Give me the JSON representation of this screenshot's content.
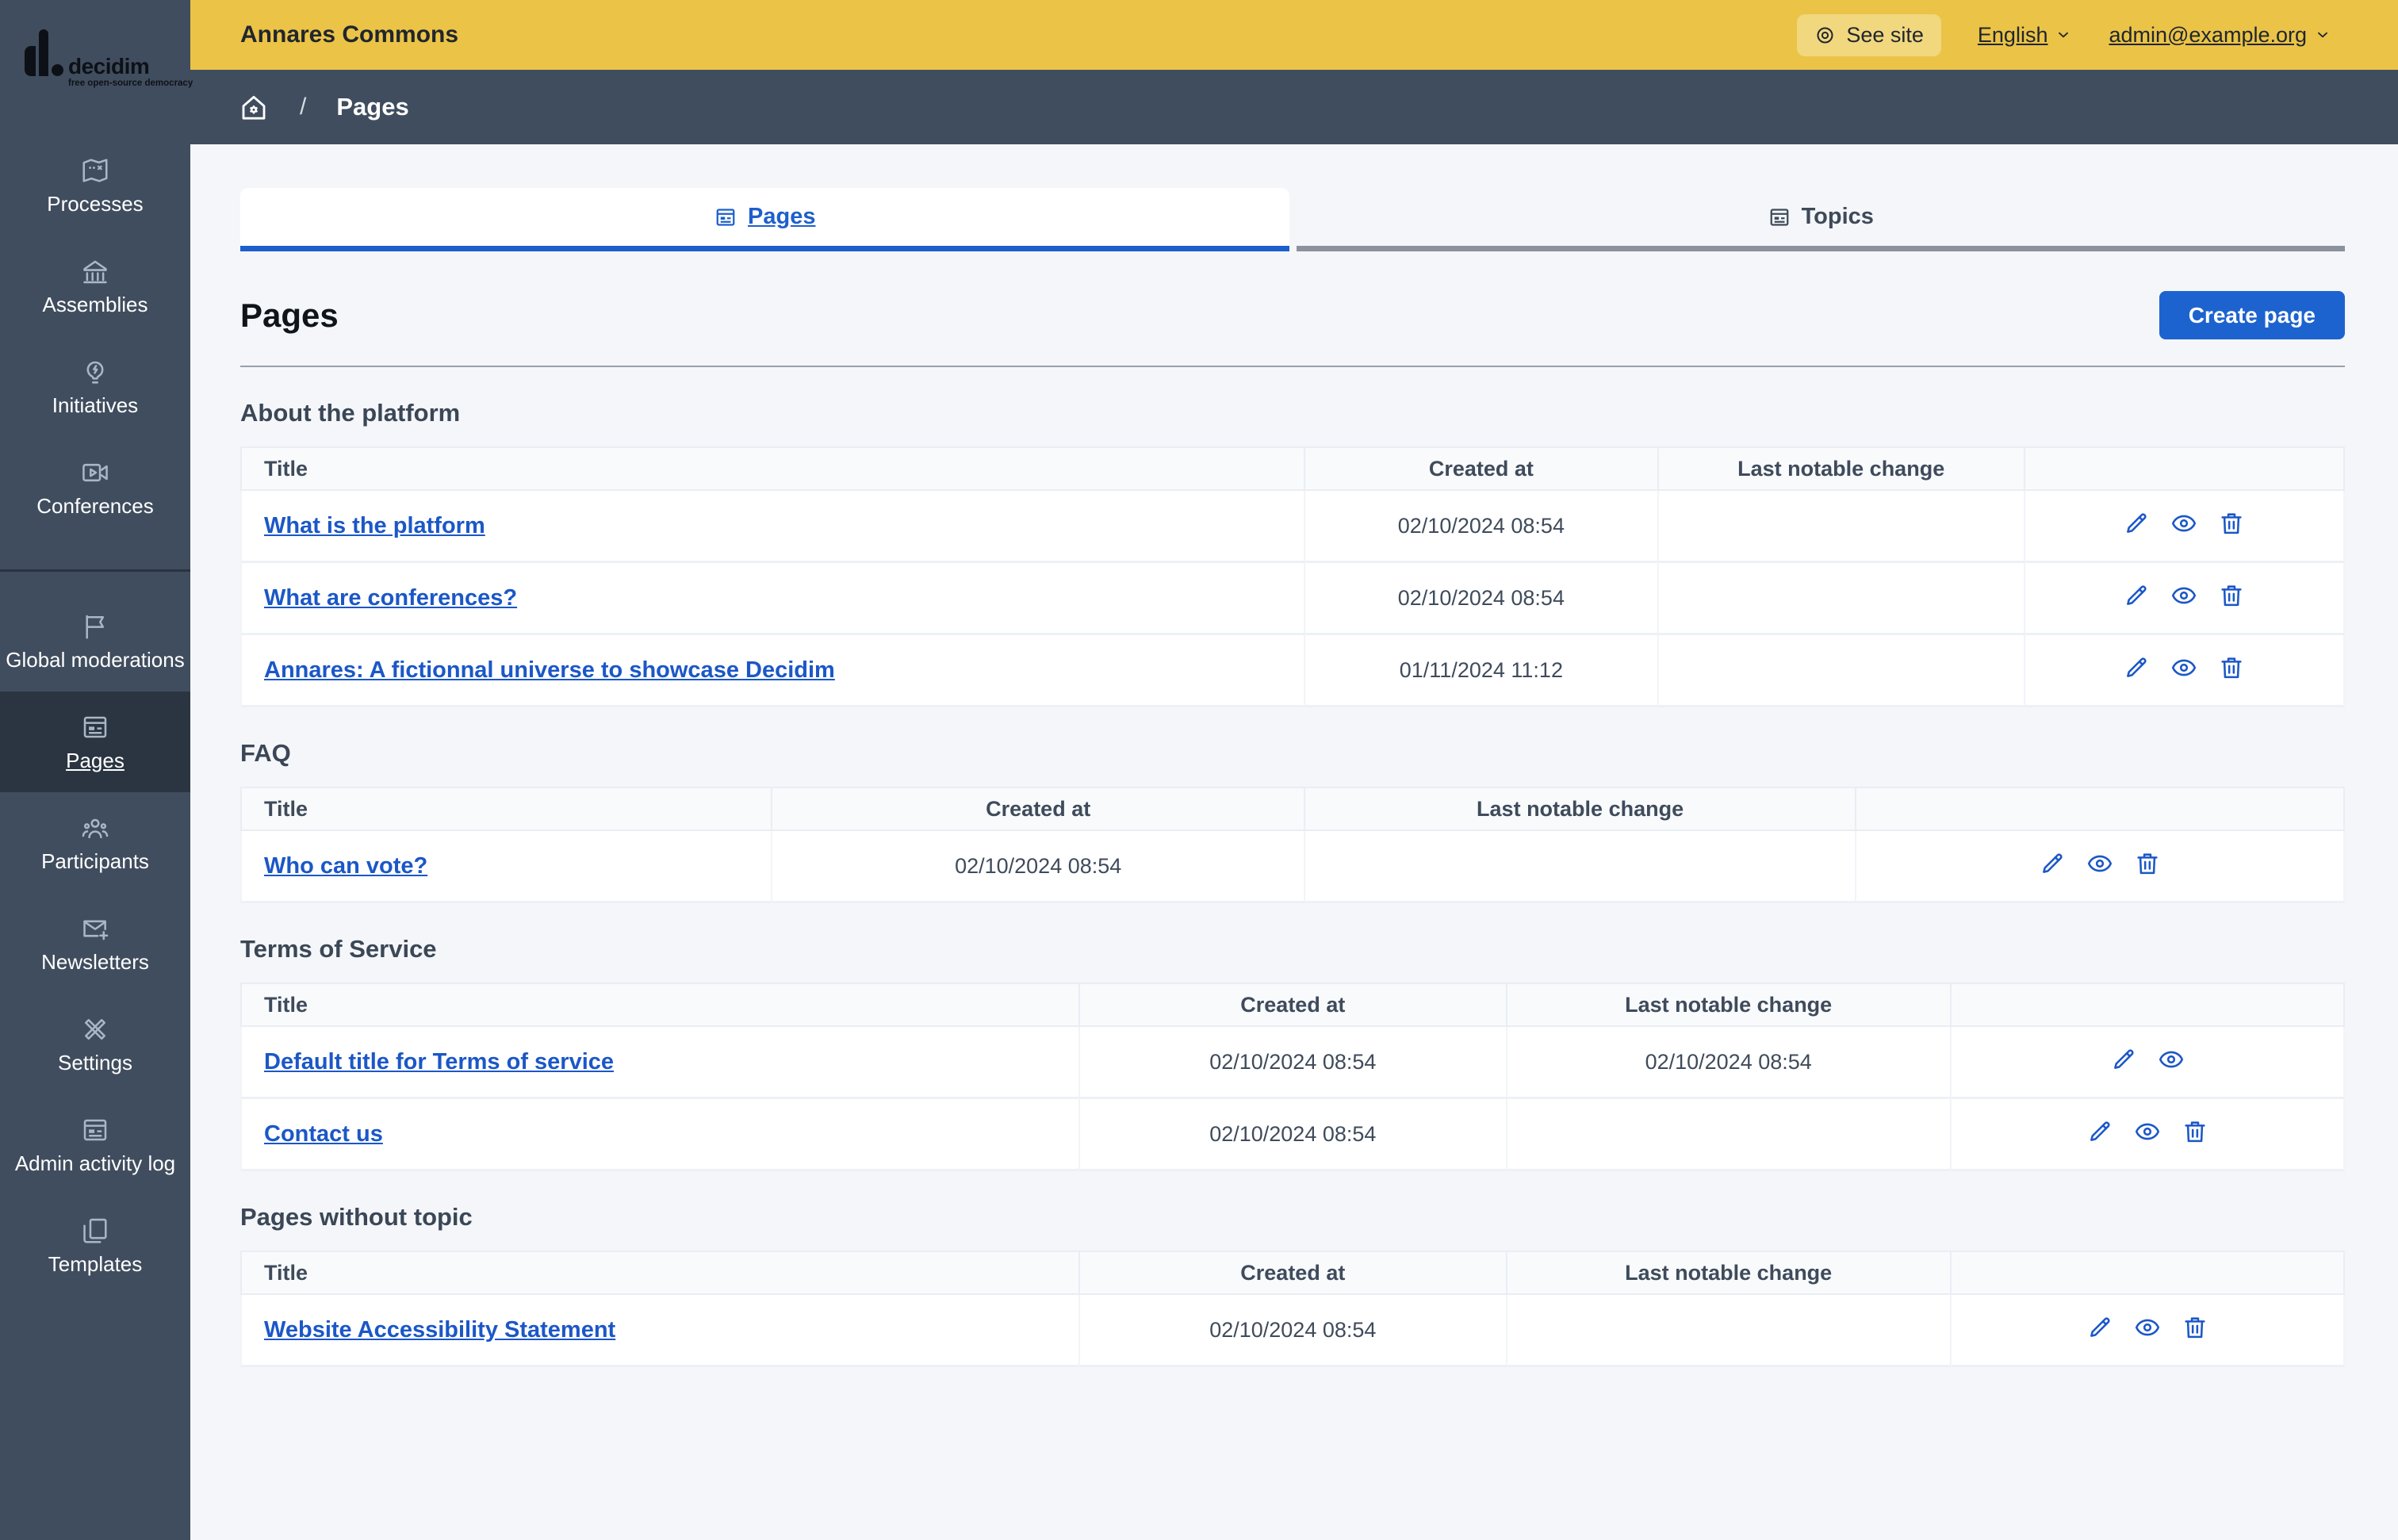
{
  "logo": {
    "brand": "decidim",
    "tagline": "free open-source democracy"
  },
  "topbar": {
    "title": "Annares Commons",
    "see_site": "See site",
    "language": "English",
    "user": "admin@example.org"
  },
  "breadcrumb": {
    "separator": "/",
    "current": "Pages"
  },
  "sidebar": {
    "items": [
      {
        "label": "Processes",
        "icon": "map-icon"
      },
      {
        "label": "Assemblies",
        "icon": "building-icon"
      },
      {
        "label": "Initiatives",
        "icon": "lightbulb-icon"
      },
      {
        "label": "Conferences",
        "icon": "video-camera-icon"
      },
      {
        "label": "Global moderations",
        "icon": "flag-icon"
      },
      {
        "label": "Pages",
        "icon": "article-icon",
        "active": true
      },
      {
        "label": "Participants",
        "icon": "people-icon"
      },
      {
        "label": "Newsletters",
        "icon": "mail-add-icon"
      },
      {
        "label": "Settings",
        "icon": "tools-icon"
      },
      {
        "label": "Admin activity log",
        "icon": "article-icon"
      },
      {
        "label": "Templates",
        "icon": "copy-icon"
      }
    ]
  },
  "tabs": [
    {
      "label": "Pages",
      "icon": "article-icon",
      "active": true
    },
    {
      "label": "Topics",
      "icon": "article-icon",
      "active": false
    }
  ],
  "page": {
    "title": "Pages",
    "create_button": "Create page"
  },
  "sections": [
    {
      "heading": "About the platform",
      "columns": [
        "Title",
        "Created at",
        "Last notable change"
      ],
      "col_widths": [
        "50.6%",
        "16.8%",
        "17.4%",
        "15.2%"
      ],
      "rows": [
        {
          "title": "What is the platform",
          "created_at": "02/10/2024 08:54",
          "last_change": "",
          "actions": [
            "edit",
            "preview",
            "delete"
          ]
        },
        {
          "title": "What are conferences?",
          "created_at": "02/10/2024 08:54",
          "last_change": "",
          "actions": [
            "edit",
            "preview",
            "delete"
          ]
        },
        {
          "title": "Annares: A fictionnal universe to showcase Decidim",
          "created_at": "01/11/2024 11:12",
          "last_change": "",
          "actions": [
            "edit",
            "preview",
            "delete"
          ]
        }
      ]
    },
    {
      "heading": "FAQ",
      "columns": [
        "Title",
        "Created at",
        "Last notable change"
      ],
      "col_widths": [
        "25.3%",
        "25.3%",
        "26.2%",
        "23.2%"
      ],
      "rows": [
        {
          "title": "Who can vote?",
          "created_at": "02/10/2024 08:54",
          "last_change": "",
          "actions": [
            "edit",
            "preview",
            "delete"
          ]
        }
      ]
    },
    {
      "heading": "Terms of Service",
      "columns": [
        "Title",
        "Created at",
        "Last notable change"
      ],
      "col_widths": [
        "39.9%",
        "20.3%",
        "21.1%",
        "18.7%"
      ],
      "rows": [
        {
          "title": "Default title for Terms of service",
          "created_at": "02/10/2024 08:54",
          "last_change": "02/10/2024 08:54",
          "actions": [
            "edit",
            "preview"
          ]
        },
        {
          "title": "Contact us",
          "created_at": "02/10/2024 08:54",
          "last_change": "",
          "actions": [
            "edit",
            "preview",
            "delete"
          ]
        }
      ]
    },
    {
      "heading": "Pages without topic",
      "columns": [
        "Title",
        "Created at",
        "Last notable change"
      ],
      "col_widths": [
        "39.9%",
        "20.3%",
        "21.1%",
        "18.7%"
      ],
      "rows": [
        {
          "title": "Website Accessibility Statement",
          "created_at": "02/10/2024 08:54",
          "last_change": "",
          "actions": [
            "edit",
            "preview",
            "delete"
          ]
        }
      ]
    }
  ],
  "colors": {
    "topbar_yellow": "#ebc347",
    "see_site_pill": "#f1d77e",
    "sidebar_dark": "#404d5e",
    "sidebar_active": "#2b3542",
    "content_bg": "#f4f6f9",
    "accent_blue": "#1b57c7",
    "button_blue": "#1d63cf",
    "tab_inactive_border": "#8b929d",
    "table_header_bg": "#f8fafc",
    "table_border": "#e9eef4",
    "heading_text": "#10151c",
    "slate_text": "#3b4756"
  }
}
